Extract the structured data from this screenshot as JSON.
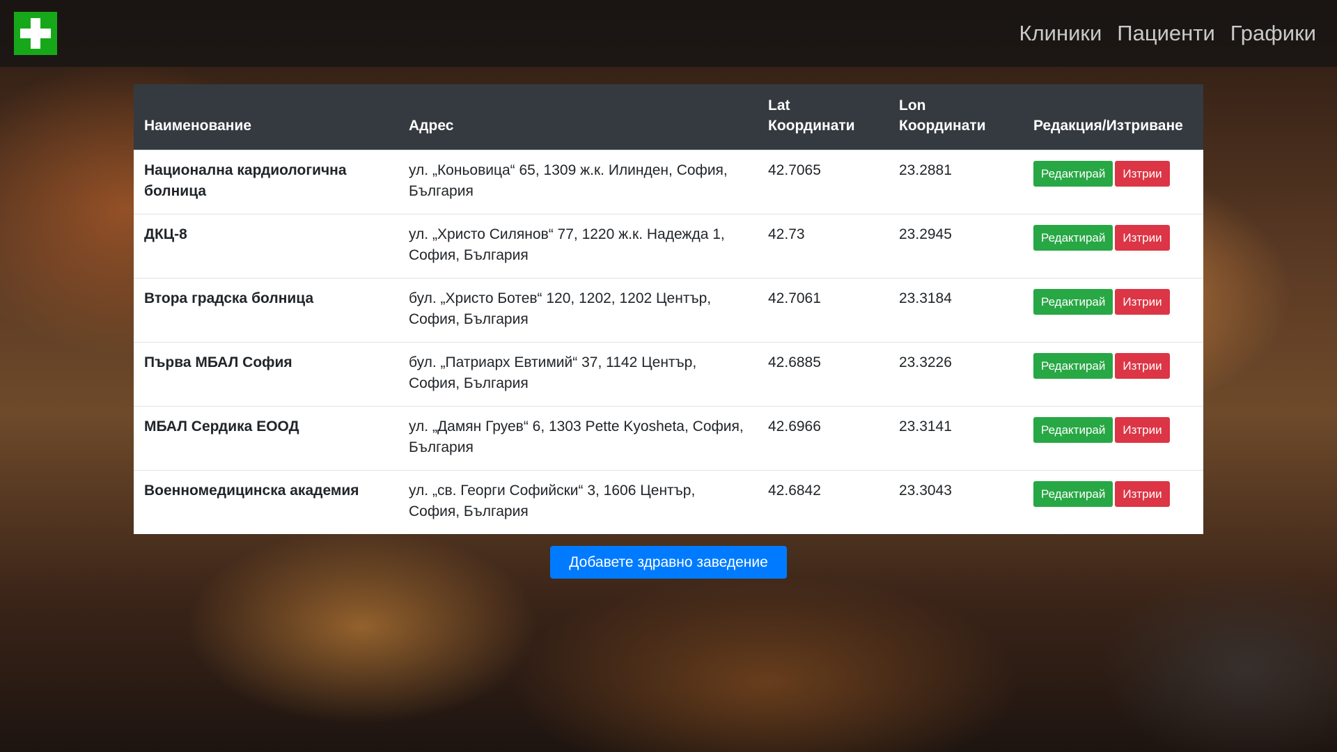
{
  "navbar": {
    "logo_icon": "medical-cross-icon",
    "logo_color": "#17a81a",
    "links": [
      "Клиники",
      "Пациенти",
      "Графики"
    ]
  },
  "table": {
    "headers": {
      "name": "Наименование",
      "address": "Адрес",
      "lat_line1": "Lat",
      "lat_line2": "Координати",
      "lon_line1": "Lon",
      "lon_line2": "Координати",
      "actions": "Редакция/Изтриване"
    },
    "rows": [
      {
        "name": "Национална кардиологична болница",
        "address": "ул. „Коньовица“ 65, 1309 ж.к. Илинден, София, България",
        "lat": "42.7065",
        "lon": "23.2881"
      },
      {
        "name": "ДКЦ-8",
        "address": "ул. „Христо Силянов“ 77, 1220 ж.к. Надежда 1, София, България",
        "lat": "42.73",
        "lon": "23.2945"
      },
      {
        "name": "Втора градска болница",
        "address": "бул. „Христо Ботев“ 120, 1202, 1202 Център, София, България",
        "lat": "42.7061",
        "lon": "23.3184"
      },
      {
        "name": "Първа МБАЛ София",
        "address": "бул. „Патриарх Евтимий“ 37, 1142 Център, София, България",
        "lat": "42.6885",
        "lon": "23.3226"
      },
      {
        "name": "МБАЛ Сердика ЕООД",
        "address": "ул. „Дамян Груев“ 6, 1303 Pette Kyosheta, София, България",
        "lat": "42.6966",
        "lon": "23.3141"
      },
      {
        "name": "Военномедицинска академия",
        "address": "ул. „св. Георги Софийски“ 3, 1606 Център, София, България",
        "lat": "42.6842",
        "lon": "23.3043"
      }
    ],
    "edit_label": "Редактирай",
    "delete_label": "Изтрии"
  },
  "add_button": "Добавете здравно заведение",
  "colors": {
    "header_bg": "#343a40",
    "edit": "#28a745",
    "delete": "#dc3545",
    "primary": "#007bff"
  }
}
